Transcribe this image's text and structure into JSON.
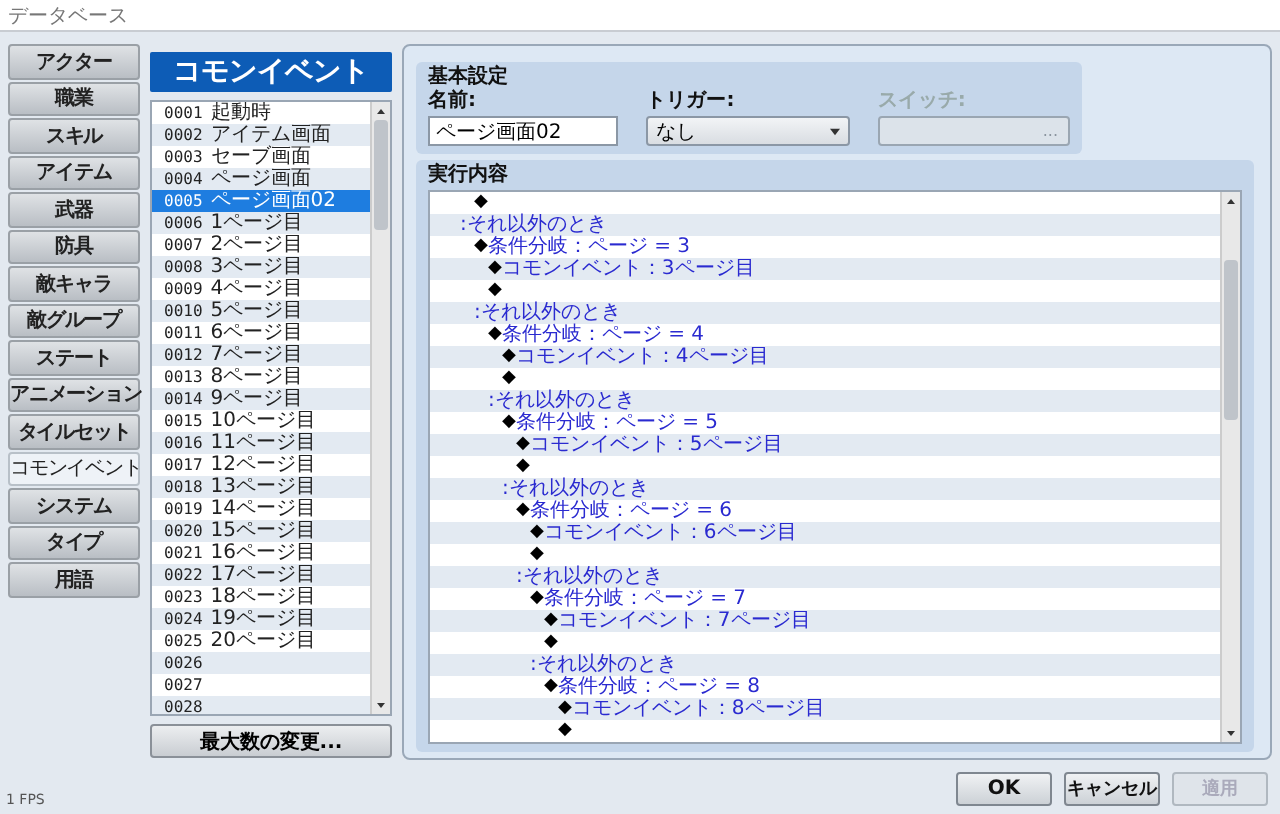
{
  "window": {
    "title": "データベース"
  },
  "tabs": [
    {
      "label": "アクター",
      "selected": false
    },
    {
      "label": "職業",
      "selected": false
    },
    {
      "label": "スキル",
      "selected": false
    },
    {
      "label": "アイテム",
      "selected": false
    },
    {
      "label": "武器",
      "selected": false
    },
    {
      "label": "防具",
      "selected": false
    },
    {
      "label": "敵キャラ",
      "selected": false
    },
    {
      "label": "敵グループ",
      "selected": false
    },
    {
      "label": "ステート",
      "selected": false
    },
    {
      "label": "アニメーション",
      "selected": false
    },
    {
      "label": "タイルセット",
      "selected": false
    },
    {
      "label": "コモンイベント",
      "selected": true
    },
    {
      "label": "システム",
      "selected": false
    },
    {
      "label": "タイプ",
      "selected": false
    },
    {
      "label": "用語",
      "selected": false
    }
  ],
  "list": {
    "title": "コモンイベント",
    "items": [
      {
        "id": "0001",
        "name": "起動時",
        "selected": false
      },
      {
        "id": "0002",
        "name": "アイテム画面",
        "selected": false
      },
      {
        "id": "0003",
        "name": "セーブ画面",
        "selected": false
      },
      {
        "id": "0004",
        "name": "ページ画面",
        "selected": false
      },
      {
        "id": "0005",
        "name": "ページ画面02",
        "selected": true
      },
      {
        "id": "0006",
        "name": "1ページ目",
        "selected": false
      },
      {
        "id": "0007",
        "name": "2ページ目",
        "selected": false
      },
      {
        "id": "0008",
        "name": "3ページ目",
        "selected": false
      },
      {
        "id": "0009",
        "name": "4ページ目",
        "selected": false
      },
      {
        "id": "0010",
        "name": "5ページ目",
        "selected": false
      },
      {
        "id": "0011",
        "name": "6ページ目",
        "selected": false
      },
      {
        "id": "0012",
        "name": "7ページ目",
        "selected": false
      },
      {
        "id": "0013",
        "name": "8ページ目",
        "selected": false
      },
      {
        "id": "0014",
        "name": "9ページ目",
        "selected": false
      },
      {
        "id": "0015",
        "name": "10ページ目",
        "selected": false
      },
      {
        "id": "0016",
        "name": "11ページ目",
        "selected": false
      },
      {
        "id": "0017",
        "name": "12ページ目",
        "selected": false
      },
      {
        "id": "0018",
        "name": "13ページ目",
        "selected": false
      },
      {
        "id": "0019",
        "name": "14ページ目",
        "selected": false
      },
      {
        "id": "0020",
        "name": "15ページ目",
        "selected": false
      },
      {
        "id": "0021",
        "name": "16ページ目",
        "selected": false
      },
      {
        "id": "0022",
        "name": "17ページ目",
        "selected": false
      },
      {
        "id": "0023",
        "name": "18ページ目",
        "selected": false
      },
      {
        "id": "0024",
        "name": "19ページ目",
        "selected": false
      },
      {
        "id": "0025",
        "name": "20ページ目",
        "selected": false
      },
      {
        "id": "0026",
        "selected": false
      },
      {
        "id": "0027",
        "selected": false
      },
      {
        "id": "0028",
        "selected": false
      }
    ],
    "button": "最大数の変更..."
  },
  "basic": {
    "title": "基本設定",
    "name_label": "名前:",
    "name_value": "ページ画面02",
    "trigger_label": "トリガー:",
    "trigger_value": "なし",
    "switch_label": "スイッチ:",
    "switch_disabled": true,
    "switch_button": "..."
  },
  "commands_title": "実行内容",
  "commands": [
    {
      "kind": "continued",
      "children": [
        {
          "kind": "end",
          "marker": "◆"
        }
      ]
    },
    {
      "kind": "else",
      "text": ":それ以外のとき",
      "children": [
        {
          "kind": "command",
          "marker": "◆",
          "text": "条件分岐：ページ = 3",
          "children": [
            {
              "kind": "command",
              "marker": "◆",
              "text": "コモンイベント：3ページ目"
            },
            {
              "kind": "end",
              "marker": "◆"
            }
          ]
        },
        {
          "kind": "else",
          "text": ":それ以外のとき",
          "children": [
            {
              "kind": "command",
              "marker": "◆",
              "text": "条件分岐：ページ = 4",
              "children": [
                {
                  "kind": "command",
                  "marker": "◆",
                  "text": "コモンイベント：4ページ目"
                },
                {
                  "kind": "end",
                  "marker": "◆"
                }
              ]
            },
            {
              "kind": "else",
              "text": ":それ以外のとき",
              "children": [
                {
                  "kind": "command",
                  "marker": "◆",
                  "text": "条件分岐：ページ = 5",
                  "children": [
                    {
                      "kind": "command",
                      "marker": "◆",
                      "text": "コモンイベント：5ページ目"
                    },
                    {
                      "kind": "end",
                      "marker": "◆"
                    }
                  ]
                },
                {
                  "kind": "else",
                  "text": ":それ以外のとき",
                  "children": [
                    {
                      "kind": "command",
                      "marker": "◆",
                      "text": "条件分岐：ページ = 6",
                      "children": [
                        {
                          "kind": "command",
                          "marker": "◆",
                          "text": "コモンイベント：6ページ目"
                        },
                        {
                          "kind": "end",
                          "marker": "◆"
                        }
                      ]
                    },
                    {
                      "kind": "else",
                      "text": ":それ以外のとき",
                      "children": [
                        {
                          "kind": "command",
                          "marker": "◆",
                          "text": "条件分岐：ページ = 7",
                          "children": [
                            {
                              "kind": "command",
                              "marker": "◆",
                              "text": "コモンイベント：7ページ目"
                            },
                            {
                              "kind": "end",
                              "marker": "◆"
                            }
                          ]
                        },
                        {
                          "kind": "else",
                          "text": ":それ以外のとき",
                          "children": [
                            {
                              "kind": "command",
                              "marker": "◆",
                              "text": "条件分岐：ページ = 8",
                              "children": [
                                {
                                  "kind": "command",
                                  "marker": "◆",
                                  "text": "コモンイベント：8ページ目"
                                },
                                {
                                  "kind": "end",
                                  "marker": "◆"
                                }
                              ]
                            }
                          ]
                        }
                      ]
                    }
                  ]
                }
              ]
            }
          ]
        }
      ]
    }
  ],
  "status": "1 FPS",
  "buttons": [
    {
      "label": "OK",
      "disabled": false
    },
    {
      "label": "キャンセル",
      "disabled": false
    },
    {
      "label": "適用",
      "disabled": true
    }
  ]
}
